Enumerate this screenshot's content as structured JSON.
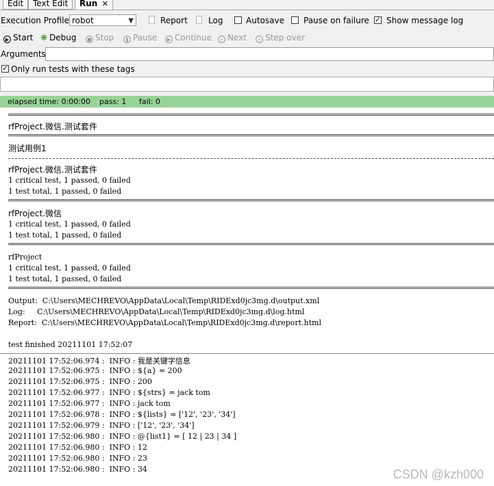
{
  "tabs": [
    {
      "label": "Edit"
    },
    {
      "label": "Text Edit"
    },
    {
      "label": "Run",
      "close": "×"
    }
  ],
  "toolbar": {
    "profile_label": "Execution Profile:",
    "profile_value": "robot",
    "report_label": "Report",
    "log_label": "Log",
    "autosave_label": "Autosave",
    "autosave_checked": false,
    "pause_label": "Pause on failure",
    "pause_checked": false,
    "show_log_label": "Show message log",
    "show_log_checked": true
  },
  "controls": {
    "start": "Start",
    "debug": "Debug",
    "stop": "Stop",
    "pause": "Pause",
    "continue": "Continue",
    "next": "Next",
    "step_over": "Step over"
  },
  "arguments": {
    "label": "Arguments:",
    "value": ""
  },
  "only_tags": {
    "label": "Only run tests with these tags",
    "checked": true,
    "value": ""
  },
  "status": {
    "elapsed": "elapsed time: 0:00:00",
    "pass": "pass: 1",
    "fail": "fail: 0",
    "color": "#98d398"
  },
  "output": {
    "suite_title": "rfProject.微信.测试套件",
    "testcase": "测试用例1",
    "suite_result_name": "rfProject.微信.测试套件",
    "suite_critical": "1 critical test, 1 passed, 0 failed",
    "suite_total": "1 test total, 1 passed, 0 failed",
    "wx_name": "rfProject.微信",
    "wx_critical": "1 critical test, 1 passed, 0 failed",
    "wx_total": "1 test total, 1 passed, 0 failed",
    "proj_name": "rfProject",
    "proj_critical": "1 critical test, 1 passed, 0 failed",
    "proj_total": "1 test total, 1 passed, 0 failed",
    "output_line": "Output:  C:\\Users\\MECHREVO\\AppData\\Local\\Temp\\RIDExd0jc3mg.d\\output.xml",
    "log_line": "Log:     C:\\Users\\MECHREVO\\AppData\\Local\\Temp\\RIDExd0jc3mg.d\\log.html",
    "report_line": "Report:  C:\\Users\\MECHREVO\\AppData\\Local\\Temp\\RIDExd0jc3mg.d\\report.html",
    "finished": "test finished 20211101 17:52:07"
  },
  "message_log": [
    "20211101 17:52:06.974 :  INFO : 我是关键字信息",
    "20211101 17:52:06.975 :  INFO : ${a} = 200",
    "20211101 17:52:06.975 :  INFO : 200",
    "20211101 17:52:06.977 :  INFO : ${strs} = jack tom",
    "20211101 17:52:06.977 :  INFO : jack tom",
    "20211101 17:52:06.978 :  INFO : ${lists} = ['12', '23', '34']",
    "20211101 17:52:06.979 :  INFO : ['12', '23', '34']",
    "20211101 17:52:06.980 :  INFO : @{list1} = [ 12 | 23 | 34 ]",
    "20211101 17:52:06.980 :  INFO : 12",
    "20211101 17:52:06.980 :  INFO : 23",
    "20211101 17:52:06.980 :  INFO : 34"
  ],
  "watermark": "CSDN @kzh000"
}
